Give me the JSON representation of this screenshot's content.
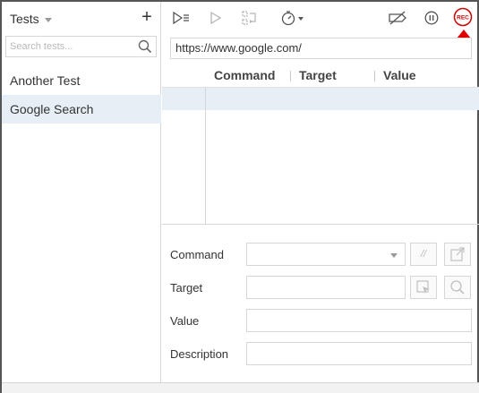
{
  "sidebar": {
    "title": "Tests",
    "add_label": "+",
    "search_placeholder": "Search tests...",
    "items": [
      {
        "label": "Another Test"
      },
      {
        "label": "Google Search"
      }
    ]
  },
  "toolbar": {
    "icons": [
      "run-all-icon",
      "run-icon",
      "step-icon",
      "speed-icon",
      "disable-breakpoints-icon",
      "pause-icon",
      "record-icon"
    ],
    "record_label": "REC"
  },
  "url": {
    "value": "https://www.google.com/"
  },
  "table": {
    "columns": [
      "Command",
      "Target",
      "Value"
    ]
  },
  "editor": {
    "command_label": "Command",
    "target_label": "Target",
    "value_label": "Value",
    "description_label": "Description",
    "comment_button_label": "//"
  },
  "colors": {
    "selection": "#e6eef6",
    "record": "#cc0000",
    "border": "#d6d6d6"
  }
}
